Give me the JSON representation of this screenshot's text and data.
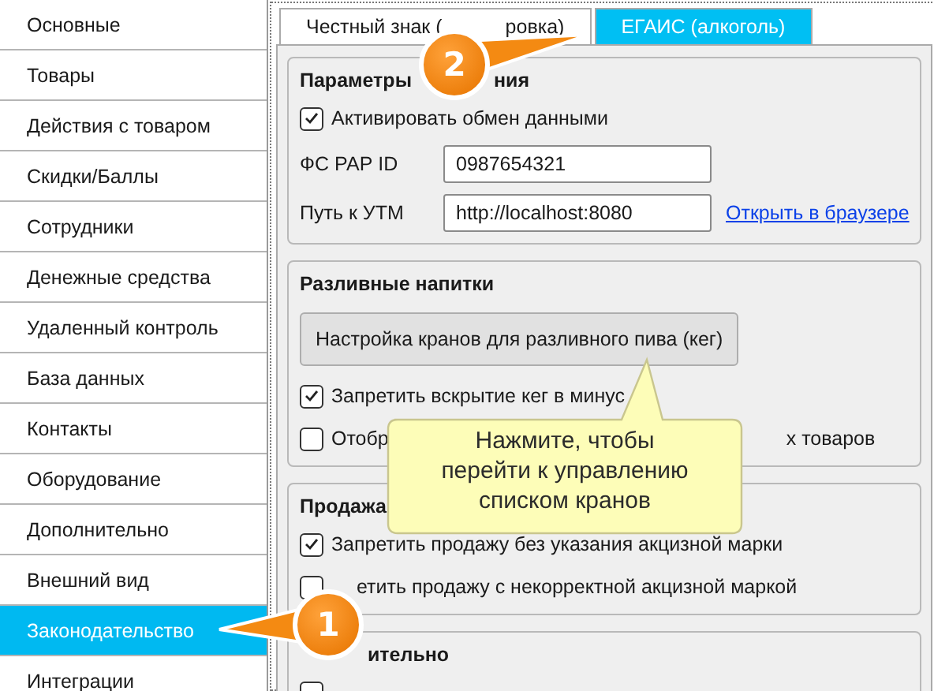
{
  "sidebar": {
    "items": [
      {
        "label": "Основные",
        "selected": false
      },
      {
        "label": "Товары",
        "selected": false
      },
      {
        "label": "Действия с товаром",
        "selected": false
      },
      {
        "label": "Скидки/Баллы",
        "selected": false
      },
      {
        "label": "Сотрудники",
        "selected": false
      },
      {
        "label": "Денежные средства",
        "selected": false
      },
      {
        "label": "Удаленный контроль",
        "selected": false
      },
      {
        "label": "База данных",
        "selected": false
      },
      {
        "label": "Контакты",
        "selected": false
      },
      {
        "label": "Оборудование",
        "selected": false
      },
      {
        "label": "Дополнительно",
        "selected": false
      },
      {
        "label": "Внешний вид",
        "selected": false
      },
      {
        "label": "Законодательство",
        "selected": true
      },
      {
        "label": "Интеграции",
        "selected": false
      }
    ]
  },
  "tabs": [
    {
      "parts": [
        "Честный знак (",
        "ровка)"
      ],
      "selected": false
    },
    {
      "parts": [
        "ЕГАИС (алкоголь)"
      ],
      "selected": true
    }
  ],
  "groups": [
    {
      "title": [
        "Параметры",
        "ния"
      ],
      "rows": [
        {
          "kind": "checkbox",
          "parts": [
            "Активировать обмен данными"
          ],
          "checked": true
        },
        {
          "kind": "field",
          "label": "ФС РАР ID",
          "value": "0987654321"
        },
        {
          "kind": "field",
          "label": "Путь к УТМ",
          "value": "http://localhost:8080",
          "link": "Открыть в браузере"
        }
      ]
    },
    {
      "title": [
        "Разливные напитки"
      ],
      "rows": [
        {
          "kind": "button",
          "label": "Настройка кранов для разливного пива (кег)"
        },
        {
          "kind": "checkbox",
          "parts": [
            "Запретить вскрытие кег в минус"
          ],
          "checked": true
        },
        {
          "kind": "checkbox",
          "parts": [
            "Отобр",
            "х товаров"
          ],
          "checked": false
        }
      ]
    },
    {
      "title": [
        "Продажа"
      ],
      "rows": [
        {
          "kind": "checkbox",
          "parts": [
            "Запретить продажу без указания акцизной марки"
          ],
          "checked": true
        },
        {
          "kind": "checkbox",
          "parts": [
            "етить продажу с некорректной акцизной маркой"
          ],
          "checked": false
        }
      ]
    },
    {
      "title": [
        "ительно"
      ],
      "rows": [
        {
          "kind": "checkbox",
          "checked": false
        }
      ]
    }
  ],
  "callouts": [
    {
      "number": "1"
    },
    {
      "number": "2"
    }
  ],
  "tooltip": {
    "text": "Нажмите, чтобы перейти к управлению списком кранов"
  }
}
